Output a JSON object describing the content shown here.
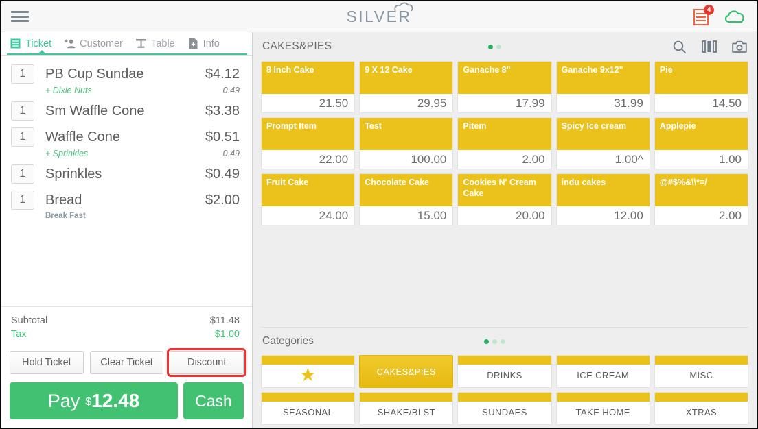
{
  "header": {
    "menu_icon": "hamburger-icon",
    "logo_text": "SILVER",
    "logo_cloud_icon": "cloud-icon",
    "receipt_icon": "receipt-icon",
    "receipt_badge": "4",
    "sync_icon": "cloud-icon",
    "accent_orange": "#f4643c",
    "badge_red": "#e8382f",
    "cloud_green": "#3bbd6e"
  },
  "ticket_panel": {
    "tabs": [
      {
        "label": "Ticket",
        "icon": "ticket-icon",
        "active": true
      },
      {
        "label": "Customer",
        "icon": "add-person-icon",
        "active": false
      },
      {
        "label": "Table",
        "icon": "table-icon",
        "active": false
      },
      {
        "label": "Info",
        "icon": "info-document-icon",
        "active": false
      }
    ],
    "items": [
      {
        "qty": "1",
        "name": "PB Cup Sundae",
        "price": "$4.12",
        "modifiers": [
          {
            "name": "+ Dixie Nuts",
            "price": "0.49",
            "style": "green"
          }
        ]
      },
      {
        "qty": "1",
        "name": "Sm Waffle Cone",
        "price": "$3.38",
        "modifiers": []
      },
      {
        "qty": "1",
        "name": "Waffle Cone",
        "price": "$0.51",
        "modifiers": [
          {
            "name": "+ Sprinkles",
            "price": "0.49",
            "style": "green"
          }
        ]
      },
      {
        "qty": "1",
        "name": "Sprinkles",
        "price": "$0.49",
        "modifiers": []
      },
      {
        "qty": "1",
        "name": "Bread",
        "price": "$2.00",
        "modifiers": [
          {
            "name": "Break Fast",
            "price": "",
            "style": "plain"
          }
        ]
      }
    ],
    "totals": [
      {
        "label": "Subtotal",
        "value": "$11.48",
        "style": "normal"
      },
      {
        "label": "Tax",
        "value": "$1.00",
        "style": "tax"
      }
    ],
    "actions": {
      "hold": "Hold Ticket",
      "clear": "Clear Ticket",
      "discount": "Discount",
      "discount_highlighted": true,
      "highlight_color": "#fb2e2e"
    },
    "pay": {
      "label": "Pay",
      "currency": "$",
      "amount": "12.48",
      "cash_label": "Cash",
      "green": "#43c173"
    }
  },
  "product_area": {
    "title": "CAKES&PIES",
    "page_dots": {
      "count": 2,
      "active_index": 0
    },
    "header_icons": [
      {
        "name": "search-icon"
      },
      {
        "name": "columns-view-icon"
      },
      {
        "name": "camera-icon"
      }
    ],
    "tile_color": "#ebc21c",
    "tiles": [
      {
        "name": "8 Inch Cake",
        "price": "21.50"
      },
      {
        "name": "9 X 12 Cake",
        "price": "29.95"
      },
      {
        "name": "Ganache 8\"",
        "price": "17.99"
      },
      {
        "name": "Ganache 9x12\"",
        "price": "31.99"
      },
      {
        "name": "Pie",
        "price": "14.50"
      },
      {
        "name": "Prompt Item",
        "price": "22.00"
      },
      {
        "name": "Test",
        "price": "100.00"
      },
      {
        "name": "Pitem",
        "price": "2.00"
      },
      {
        "name": "Spicy Ice cream",
        "price": "1.00^"
      },
      {
        "name": "Applepie",
        "price": "1.00"
      },
      {
        "name": "Fruit Cake",
        "price": "24.00"
      },
      {
        "name": "Chocolate Cake",
        "price": "15.00"
      },
      {
        "name": "Cookies N' Cream Cake",
        "price": "20.00"
      },
      {
        "name": "indu cakes",
        "price": "12.00"
      },
      {
        "name": "@#$%&\\\\*=/",
        "price": "2.00"
      }
    ]
  },
  "categories": {
    "title": "Categories",
    "page_dots": {
      "count": 3,
      "active_index": 0
    },
    "row1": [
      {
        "label": "",
        "icon": "star-icon",
        "selected": false
      },
      {
        "label": "CAKES&PIES",
        "icon": "",
        "selected": true
      },
      {
        "label": "DRINKS",
        "icon": "",
        "selected": false
      },
      {
        "label": "ICE CREAM",
        "icon": "",
        "selected": false
      },
      {
        "label": "MISC",
        "icon": "",
        "selected": false
      }
    ],
    "row2": [
      {
        "label": "SEASONAL",
        "icon": "",
        "selected": false
      },
      {
        "label": "SHAKE/BLST",
        "icon": "",
        "selected": false
      },
      {
        "label": "SUNDAES",
        "icon": "",
        "selected": false
      },
      {
        "label": "TAKE HOME",
        "icon": "",
        "selected": false
      },
      {
        "label": "XTRAS",
        "icon": "",
        "selected": false
      }
    ]
  }
}
